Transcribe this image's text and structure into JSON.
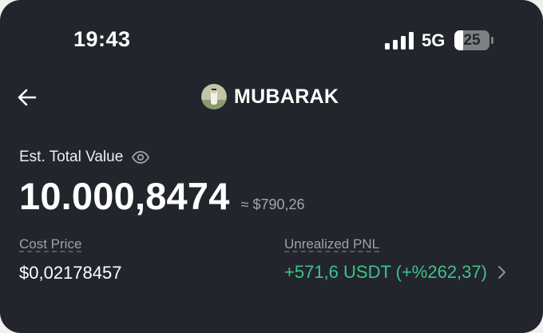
{
  "status_bar": {
    "time": "19:43",
    "network": "5G",
    "battery": "25",
    "battery_level_percent": 25
  },
  "header": {
    "back_icon": "arrow-left-icon",
    "token_icon": "token-avatar",
    "title": "MUBARAK"
  },
  "balance": {
    "label": "Est. Total Value",
    "visibility_icon": "eye-icon",
    "amount": "10.000,8474",
    "approx_value": "≈ $790,26"
  },
  "stats": {
    "cost_price": {
      "label": "Cost Price",
      "value": "$0,02178457"
    },
    "unrealized_pnl": {
      "label": "Unrealized PNL",
      "value": "+571,6 USDT (+%262,37)",
      "color": "#3fc18f",
      "chevron_icon": "chevron-right-icon"
    }
  },
  "colors": {
    "background": "#22252b",
    "text_primary": "#ffffff",
    "text_secondary": "#9ea2a9",
    "positive": "#3fc18f"
  }
}
